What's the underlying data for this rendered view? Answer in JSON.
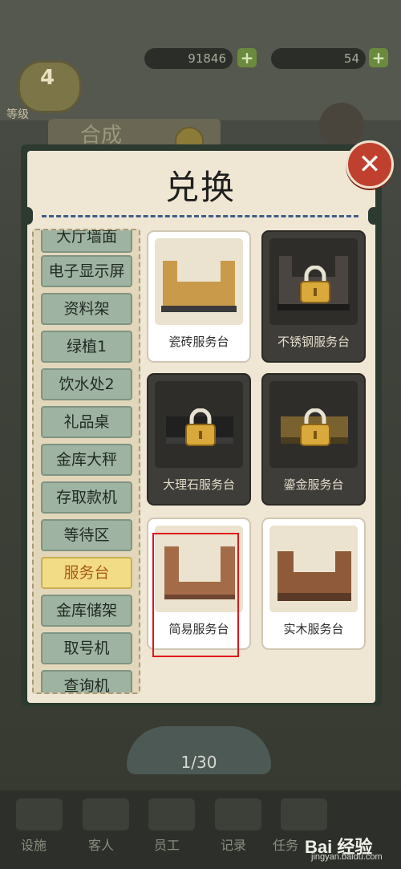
{
  "background": {
    "level": "4",
    "level_label": "等级",
    "gold_value": "91846",
    "gem_value": "54",
    "tab_label": "合成",
    "pager": "1/30",
    "nav": [
      "设施",
      "客人",
      "员工",
      "记录",
      "任务"
    ]
  },
  "dialog": {
    "title": "兑换",
    "close_icon": "close-icon"
  },
  "categories": [
    {
      "label": "大厅墙面",
      "selected": false
    },
    {
      "label": "电子显示屏",
      "selected": false
    },
    {
      "label": "资料架",
      "selected": false
    },
    {
      "label": "绿植1",
      "selected": false
    },
    {
      "label": "饮水处2",
      "selected": false
    },
    {
      "label": "礼品桌",
      "selected": false
    },
    {
      "label": "金库大秤",
      "selected": false
    },
    {
      "label": "存取款机",
      "selected": false
    },
    {
      "label": "等待区",
      "selected": false
    },
    {
      "label": "服务台",
      "selected": true
    },
    {
      "label": "金库储架",
      "selected": false
    },
    {
      "label": "取号机",
      "selected": false
    },
    {
      "label": "查询机",
      "selected": false
    }
  ],
  "items": [
    {
      "label": "瓷砖服务台",
      "locked": false,
      "color": "#c99a4a"
    },
    {
      "label": "不锈钢服务台",
      "locked": true,
      "color": "#4a4540"
    },
    {
      "label": "大理石服务台",
      "locked": true,
      "color": "#202020"
    },
    {
      "label": "鎏金服务台",
      "locked": true,
      "color": "#7a6230"
    },
    {
      "label": "简易服务台",
      "locked": false,
      "color": "#a46b48"
    },
    {
      "label": "实木服务台",
      "locked": false,
      "color": "#8e5a3a"
    }
  ],
  "watermark": {
    "text": "Bai 经验",
    "sub": "jingyan.baidu.com"
  }
}
